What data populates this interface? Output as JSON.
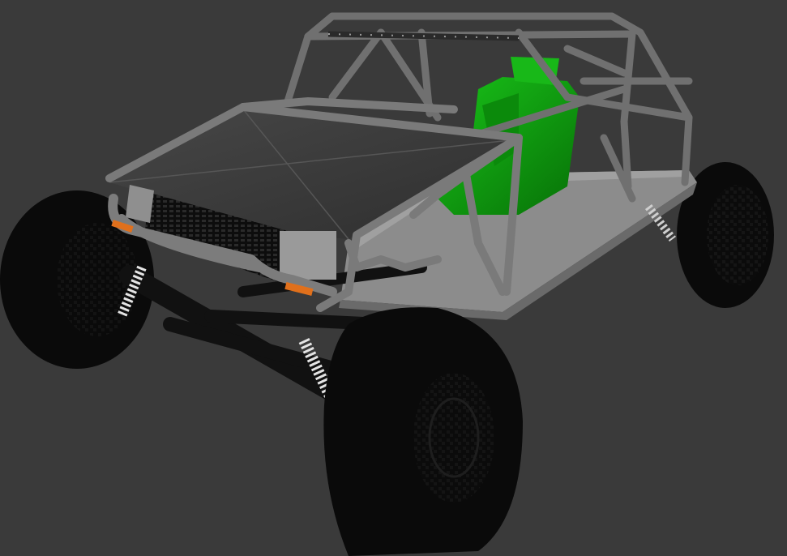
{
  "scene": {
    "subject": "",
    "colors": {
      "background": "#3a3a3a",
      "tire": "#0a0a0a",
      "tube": "#6e6e6e",
      "tube_light": "#8a8a8a",
      "panel": "#3c3c3c",
      "seat": "#0fa30f",
      "seat_dark": "#0a6e0a",
      "chassis": "#8c8c8c",
      "spring": "#d8d8d8",
      "orange": "#e0701c"
    }
  }
}
